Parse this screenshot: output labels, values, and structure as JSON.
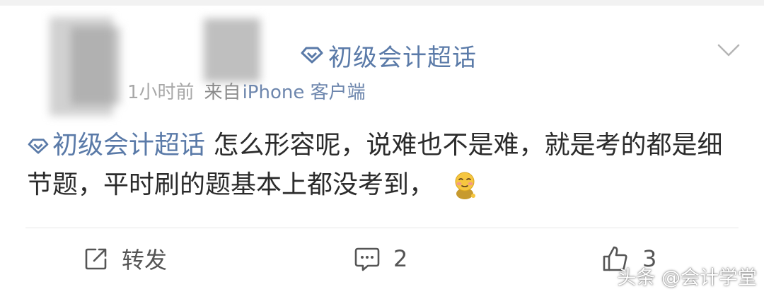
{
  "post": {
    "header": {
      "super_topic": "初级会计超话",
      "time": "1小时前",
      "source_prefix": "来自",
      "device": "iPhone 客户端"
    },
    "body": {
      "topic_tag": "初级会计超话",
      "text": " 怎么形容呢，说难也不是难，就是考的都是细节题，平时刷的题基本上都没考到，",
      "emoji": "shy-face-emoji"
    },
    "actions": {
      "repost_label": "转发",
      "comment_count": "2",
      "like_count": "3"
    }
  },
  "watermark": "头条 @会计学堂",
  "colors": {
    "topic_link": "#5a7aa8",
    "meta_text": "#8b8b8b",
    "body_text": "#2b2b2b",
    "divider": "#e7e7e7"
  }
}
